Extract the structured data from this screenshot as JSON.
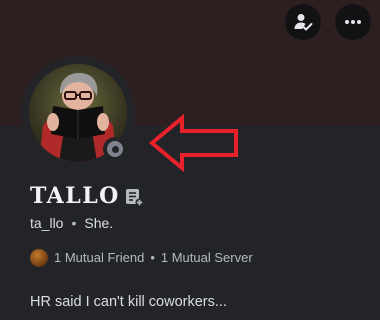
{
  "profile": {
    "display_name": "TALLO",
    "username": "ta_llo",
    "pronouns": "She.",
    "status": "offline",
    "mutual_friends": "1 Mutual Friend",
    "mutual_servers": "1 Mutual Server",
    "bio": "HR said I can't kill coworkers..."
  },
  "icons": {
    "top_left_button": "user-check-icon",
    "top_right_button": "more-dots-icon",
    "note": "note-add-icon"
  },
  "colors": {
    "banner": "#2d1e20",
    "card_background": "#232428",
    "status_offline": "#80848e",
    "annotation_arrow": "#e8212b"
  }
}
